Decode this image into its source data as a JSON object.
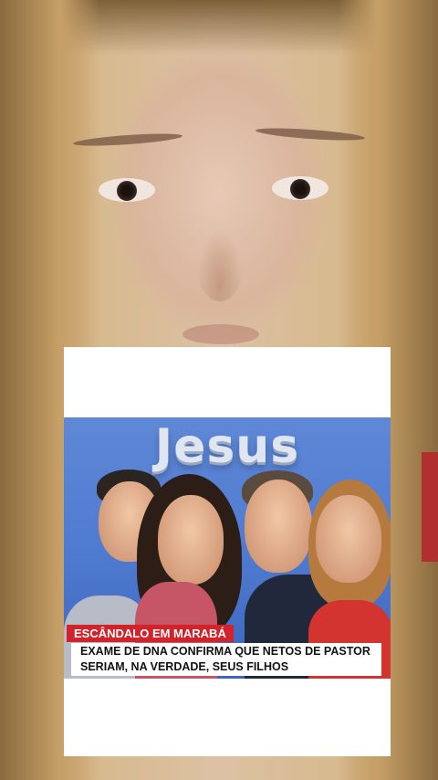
{
  "background": {
    "description_colors": {
      "skin": "#d9b59c",
      "hair": "#c6a068",
      "shirt": "#b1302f"
    }
  },
  "news_card": {
    "banner_word": "Jesus",
    "category_tag": "ESCÂNDALO EM MARABÁ",
    "headline": "EXAME DE DNA CONFIRMA QUE NETOS DE PASTOR SERIAM, NA VERDADE, SEUS FILHOS",
    "colors": {
      "tag_bg": "#d3232a",
      "banner_bg": "#4f7bd1"
    }
  }
}
